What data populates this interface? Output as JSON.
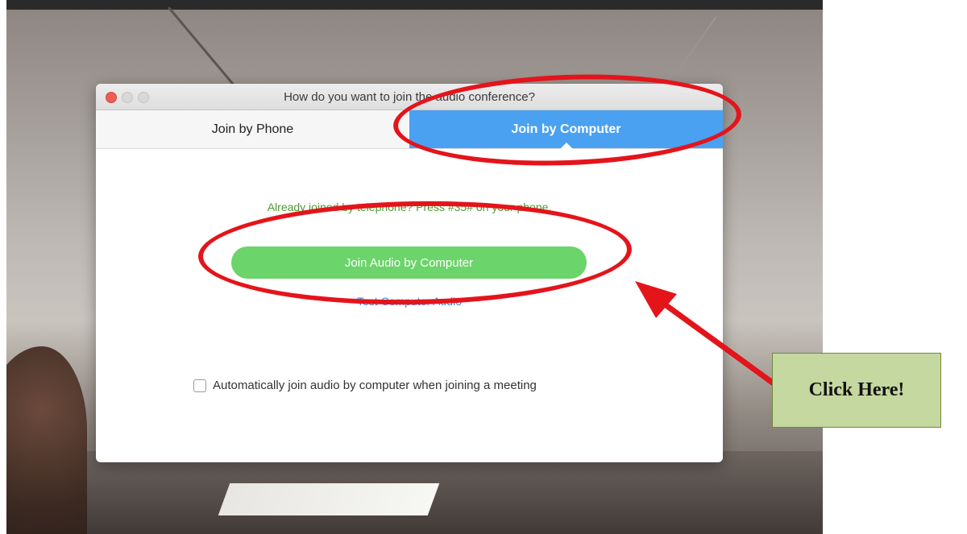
{
  "window": {
    "title": "How do you want to join the audio conference?"
  },
  "tabs": [
    {
      "label": "Join by Phone",
      "selected": false
    },
    {
      "label": "Join by Computer",
      "selected": true
    }
  ],
  "content": {
    "already_joined": "Already joined by telephone? Press #35# on your phone.",
    "join_button": "Join Audio by Computer",
    "test_link": "Test Computer Audio",
    "auto_join_label": "Automatically join audio by computer when joining a meeting",
    "auto_join_checked": false
  },
  "annotation": {
    "callout": "Click Here!",
    "highlight_color": "#e4141b",
    "callout_color": "#c4d89f"
  },
  "colors": {
    "tab_active": "#4aa1f2",
    "join_button": "#6bd46a",
    "link": "#3d86d9",
    "info_text": "#4f9a2f"
  }
}
